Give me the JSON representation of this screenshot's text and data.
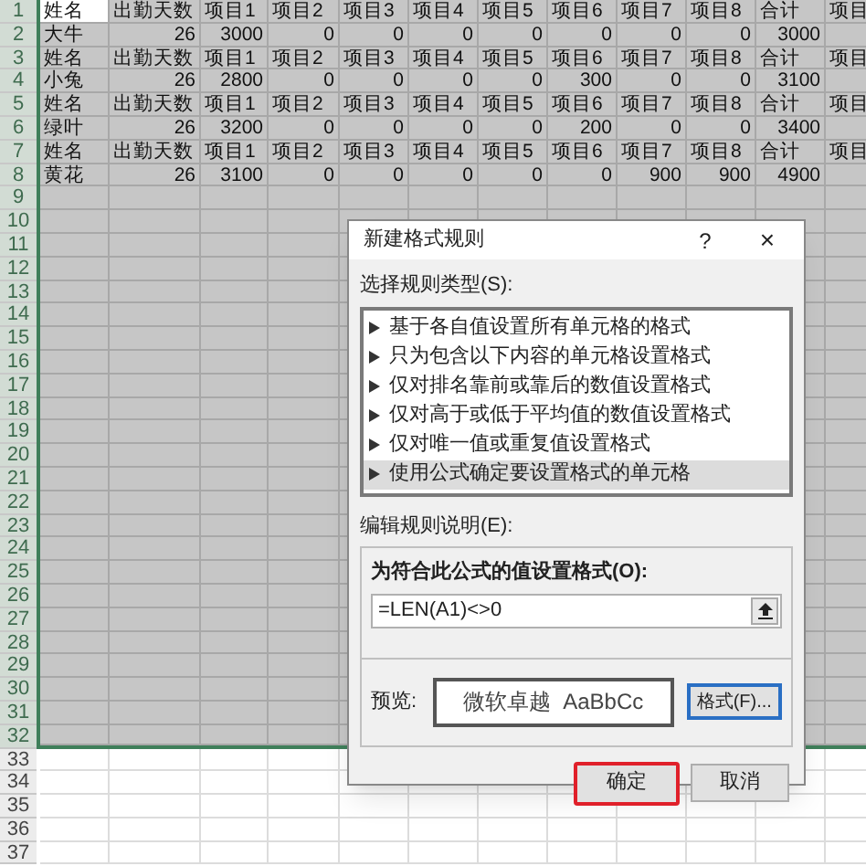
{
  "sheet": {
    "rows": [
      {
        "number": "1",
        "kind": "header",
        "selected": true,
        "cells": [
          "姓名",
          "出勤天数",
          "项目1",
          "项目2",
          "项目3",
          "项目4",
          "项目5",
          "项目6",
          "项目7",
          "项目8",
          "合计",
          "项目"
        ]
      },
      {
        "number": "2",
        "kind": "data",
        "selected": true,
        "cells": [
          "大牛",
          "26",
          "3000",
          "0",
          "0",
          "0",
          "0",
          "0",
          "0",
          "0",
          "3000",
          ""
        ]
      },
      {
        "number": "3",
        "kind": "header",
        "selected": true,
        "cells": [
          "姓名",
          "出勤天数",
          "项目1",
          "项目2",
          "项目3",
          "项目4",
          "项目5",
          "项目6",
          "项目7",
          "项目8",
          "合计",
          "项目"
        ]
      },
      {
        "number": "4",
        "kind": "data",
        "selected": true,
        "cells": [
          "小兔",
          "26",
          "2800",
          "0",
          "0",
          "0",
          "0",
          "300",
          "0",
          "0",
          "3100",
          ""
        ]
      },
      {
        "number": "5",
        "kind": "header",
        "selected": true,
        "cells": [
          "姓名",
          "出勤天数",
          "项目1",
          "项目2",
          "项目3",
          "项目4",
          "项目5",
          "项目6",
          "项目7",
          "项目8",
          "合计",
          "项目"
        ]
      },
      {
        "number": "6",
        "kind": "data",
        "selected": true,
        "cells": [
          "绿叶",
          "26",
          "3200",
          "0",
          "0",
          "0",
          "0",
          "200",
          "0",
          "0",
          "3400",
          ""
        ]
      },
      {
        "number": "7",
        "kind": "header",
        "selected": true,
        "cells": [
          "姓名",
          "出勤天数",
          "项目1",
          "项目2",
          "项目3",
          "项目4",
          "项目5",
          "项目6",
          "项目7",
          "项目8",
          "合计",
          "项目"
        ]
      },
      {
        "number": "8",
        "kind": "data",
        "selected": true,
        "cells": [
          "黄花",
          "26",
          "3100",
          "0",
          "0",
          "0",
          "0",
          "0",
          "900",
          "900",
          "4900",
          ""
        ]
      },
      {
        "number": "9",
        "kind": "data",
        "selected": true,
        "cells": []
      },
      {
        "number": "10",
        "kind": "data",
        "selected": true,
        "cells": []
      },
      {
        "number": "11",
        "kind": "data",
        "selected": true,
        "cells": []
      },
      {
        "number": "12",
        "kind": "data",
        "selected": true,
        "cells": []
      },
      {
        "number": "13",
        "kind": "data",
        "selected": true,
        "cells": []
      },
      {
        "number": "14",
        "kind": "data",
        "selected": true,
        "cells": []
      },
      {
        "number": "15",
        "kind": "data",
        "selected": true,
        "cells": []
      },
      {
        "number": "16",
        "kind": "data",
        "selected": true,
        "cells": []
      },
      {
        "number": "17",
        "kind": "data",
        "selected": true,
        "cells": []
      },
      {
        "number": "18",
        "kind": "data",
        "selected": true,
        "cells": []
      },
      {
        "number": "19",
        "kind": "data",
        "selected": true,
        "cells": []
      },
      {
        "number": "20",
        "kind": "data",
        "selected": true,
        "cells": []
      },
      {
        "number": "21",
        "kind": "data",
        "selected": true,
        "cells": []
      },
      {
        "number": "22",
        "kind": "data",
        "selected": true,
        "cells": []
      },
      {
        "number": "23",
        "kind": "data",
        "selected": true,
        "cells": []
      },
      {
        "number": "24",
        "kind": "data",
        "selected": true,
        "cells": []
      },
      {
        "number": "25",
        "kind": "data",
        "selected": true,
        "cells": []
      },
      {
        "number": "26",
        "kind": "data",
        "selected": true,
        "cells": []
      },
      {
        "number": "27",
        "kind": "data",
        "selected": true,
        "cells": []
      },
      {
        "number": "28",
        "kind": "data",
        "selected": true,
        "cells": []
      },
      {
        "number": "29",
        "kind": "data",
        "selected": true,
        "cells": []
      },
      {
        "number": "30",
        "kind": "data",
        "selected": true,
        "cells": []
      },
      {
        "number": "31",
        "kind": "data",
        "selected": true,
        "cells": []
      },
      {
        "number": "32",
        "kind": "data",
        "selected": true,
        "cells": []
      },
      {
        "number": "33",
        "kind": "data",
        "selected": false,
        "cells": []
      },
      {
        "number": "34",
        "kind": "data",
        "selected": false,
        "cells": []
      },
      {
        "number": "35",
        "kind": "data",
        "selected": false,
        "cells": []
      },
      {
        "number": "36",
        "kind": "data",
        "selected": false,
        "cells": []
      },
      {
        "number": "37",
        "kind": "data",
        "selected": false,
        "cells": []
      }
    ]
  },
  "dialog": {
    "title": "新建格式规则",
    "help": "?",
    "close": "×",
    "rule_type_label": "选择规则类型(S):",
    "rule_types": [
      {
        "label": "基于各自值设置所有单元格的格式",
        "selected": false
      },
      {
        "label": "只为包含以下内容的单元格设置格式",
        "selected": false
      },
      {
        "label": "仅对排名靠前或靠后的数值设置格式",
        "selected": false
      },
      {
        "label": "仅对高于或低于平均值的数值设置格式",
        "selected": false
      },
      {
        "label": "仅对唯一值或重复值设置格式",
        "selected": false
      },
      {
        "label": "使用公式确定要设置格式的单元格",
        "selected": true
      }
    ],
    "edit_label": "编辑规则说明(E):",
    "formula_label": "为符合此公式的值设置格式(O):",
    "formula_value": "=LEN(A1)<>0",
    "preview_label": "预览:",
    "preview_text": "微软卓越  AaBbCc",
    "format_button": "格式(F)...",
    "buttons": [
      {
        "label": "确定",
        "highlighted": true
      },
      {
        "label": "取消",
        "highlighted": false
      }
    ]
  }
}
